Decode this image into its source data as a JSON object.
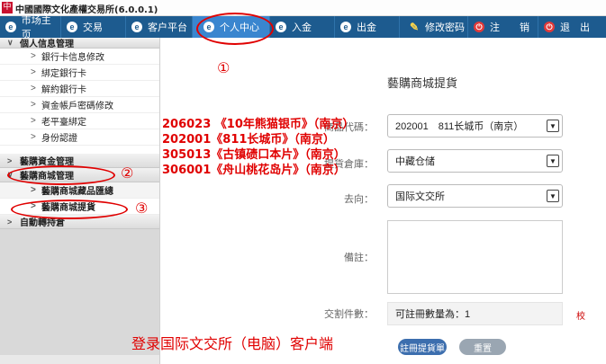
{
  "window": {
    "logo_char": "中",
    "title": "中國國際文化產權交易所(6.0.0.1)"
  },
  "nav": {
    "items": [
      {
        "label": "市场主页",
        "icon": "c-circle-icon"
      },
      {
        "label": "交易",
        "icon": "c-circle-icon"
      },
      {
        "label": "客户平台",
        "icon": "c-circle-icon"
      },
      {
        "label": "个人中心",
        "icon": "c-circle-icon",
        "active": true
      },
      {
        "label": "入金",
        "icon": "c-circle-icon"
      },
      {
        "label": "出金",
        "icon": "c-circle-icon"
      },
      {
        "label": "修改密码",
        "icon": "person-icon"
      },
      {
        "label": "注　　销",
        "icon": "power-icon"
      },
      {
        "label": "退　出",
        "icon": "power-icon"
      }
    ]
  },
  "sidebar": {
    "group_personal": "個人信息管理",
    "personal_items": [
      "銀行卡信息修改",
      "綁定銀行卡",
      "解約銀行卡",
      "資金帳戶密碼修改",
      "老平臺綁定",
      "身份認證"
    ],
    "group_funds": "藝購資金管理",
    "group_mall": "藝購商城管理",
    "mall_items": [
      "藝購商城藏品匯總",
      "藝購商城提貨"
    ],
    "group_auto": "自動轉持倉"
  },
  "form": {
    "page_title": "藝購商城提貨",
    "product_code_label": "商品代碼：",
    "product_code_value": "202001　811长城币（南京）",
    "warehouse_label": "提貨倉庫：",
    "warehouse_value": "中藏仓储",
    "destination_label": "去向：",
    "destination_value": "国际文交所",
    "remark_label": "備註：",
    "remark_value": "",
    "quantity_label": "交割件數：",
    "quantity_value": "可註冊數量為：1",
    "quantity_note": "校",
    "submit_label": "註冊提貨單",
    "reset_label": "重置"
  },
  "annotations": {
    "product_list": [
      "206023 《10年熊猫银币》（南京）",
      "202001《811长城币》（南京）",
      "305013《古镇碛口本片》（南京）",
      "306001《舟山桃花岛片》（南京）"
    ],
    "step1": "①",
    "step2": "②",
    "step3": "③",
    "caption": "登录国际文交所（电脑）客户端"
  },
  "colors": {
    "nav_bg": "#1d5b8f",
    "nav_active": "#3a86cf",
    "annotation": "#e00000",
    "primary_button": "#3c6eae"
  }
}
